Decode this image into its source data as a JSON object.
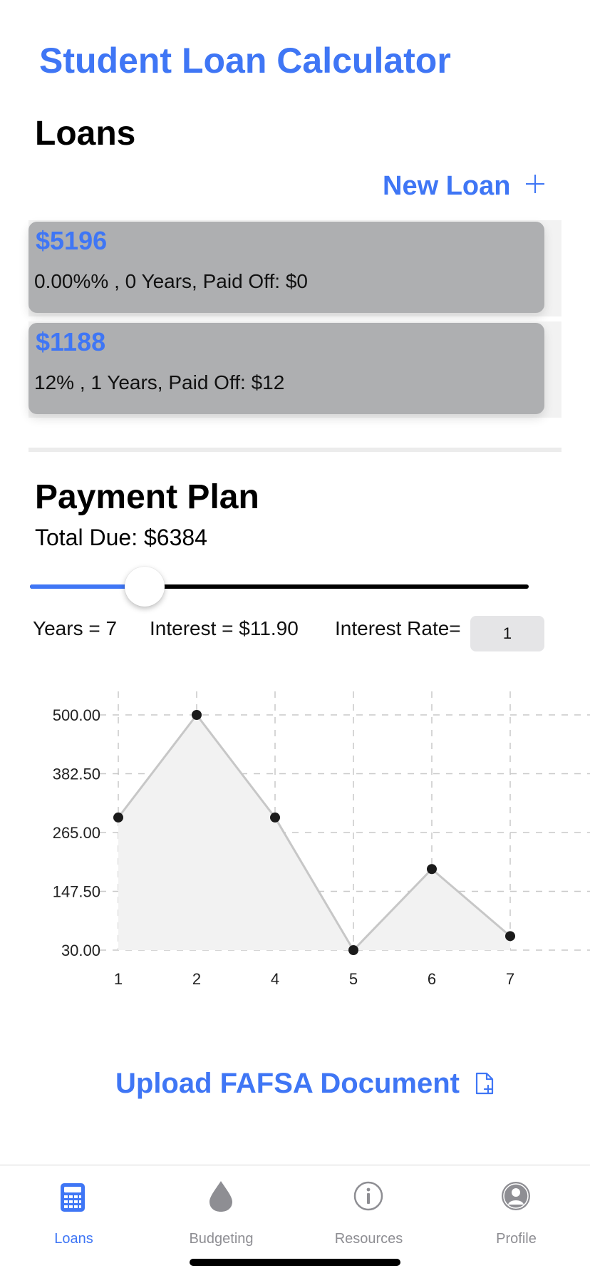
{
  "app": {
    "title": "Student Loan Calculator"
  },
  "loans": {
    "heading": "Loans",
    "new_loan_label": "New Loan",
    "items": [
      {
        "amount": "$5196",
        "details": "0.00%% , 0 Years,  Paid Off: $0"
      },
      {
        "amount": "$1188",
        "details": "12% , 1 Years,  Paid Off: $12"
      }
    ]
  },
  "payment_plan": {
    "heading": "Payment Plan",
    "total_due": "Total Due: $6384",
    "slider_fraction": 0.23,
    "years": "Years = 7",
    "interest": "Interest = $11.90",
    "interest_rate_label": "Interest Rate=",
    "interest_rate_value": "1"
  },
  "chart_data": {
    "type": "area",
    "x": [
      "1",
      "2",
      "4",
      "5",
      "6",
      "7"
    ],
    "values": [
      295,
      500,
      295,
      30,
      192,
      58
    ],
    "yticks": [
      "500.00",
      "382.50",
      "265.00",
      "147.50",
      "30.00"
    ],
    "ylim": [
      30,
      500
    ],
    "grid": true,
    "line_color": "#c7c7c7",
    "fill_color": "#f2f2f2",
    "point_color": "#1a1a1a"
  },
  "upload": {
    "label": "Upload FAFSA Document"
  },
  "tabbar": {
    "items": [
      {
        "label": "Loans",
        "icon": "calculator-icon",
        "active": true
      },
      {
        "label": "Budgeting",
        "icon": "drop-icon",
        "active": false
      },
      {
        "label": "Resources",
        "icon": "info-icon",
        "active": false
      },
      {
        "label": "Profile",
        "icon": "person-icon",
        "active": false
      }
    ]
  },
  "colors": {
    "accent": "#3f76f5",
    "card": "#aeafb1"
  }
}
